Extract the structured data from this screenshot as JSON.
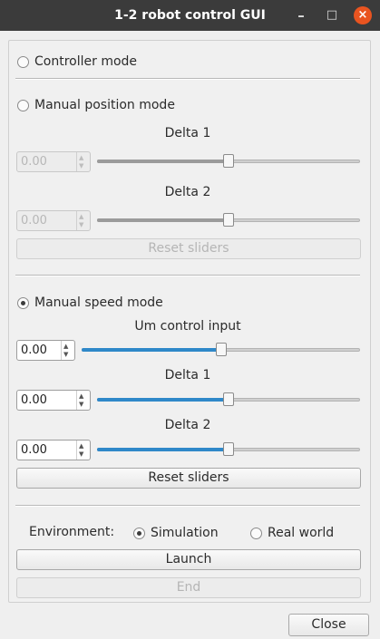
{
  "window": {
    "title": "1-2 robot control GUI",
    "minimize_glyph": "–",
    "maximize_glyph": "□",
    "close_glyph": "×"
  },
  "controller_mode": {
    "label": "Controller mode",
    "checked": false
  },
  "manual_position": {
    "label": "Manual position mode",
    "checked": false,
    "delta1": {
      "label": "Delta 1",
      "value": "0.00",
      "slider_fraction": 0.5
    },
    "delta2": {
      "label": "Delta 2",
      "value": "0.00",
      "slider_fraction": 0.5
    },
    "reset_label": "Reset sliders"
  },
  "manual_speed": {
    "label": "Manual speed mode",
    "checked": true,
    "um": {
      "label": "Um control input",
      "value": "0.00",
      "slider_fraction": 0.5
    },
    "delta1": {
      "label": "Delta 1",
      "value": "0.00",
      "slider_fraction": 0.5
    },
    "delta2": {
      "label": "Delta 2",
      "value": "0.00",
      "slider_fraction": 0.5
    },
    "reset_label": "Reset sliders"
  },
  "environment": {
    "label": "Environment:",
    "options": [
      {
        "label": "Simulation",
        "checked": true
      },
      {
        "label": "Real world",
        "checked": false
      }
    ]
  },
  "launch_label": "Launch",
  "end_label": "End",
  "close_label": "Close",
  "colors": {
    "titlebar": "#3b3b3b",
    "close_button": "#e95420",
    "slider_active": "#2f88c9"
  }
}
